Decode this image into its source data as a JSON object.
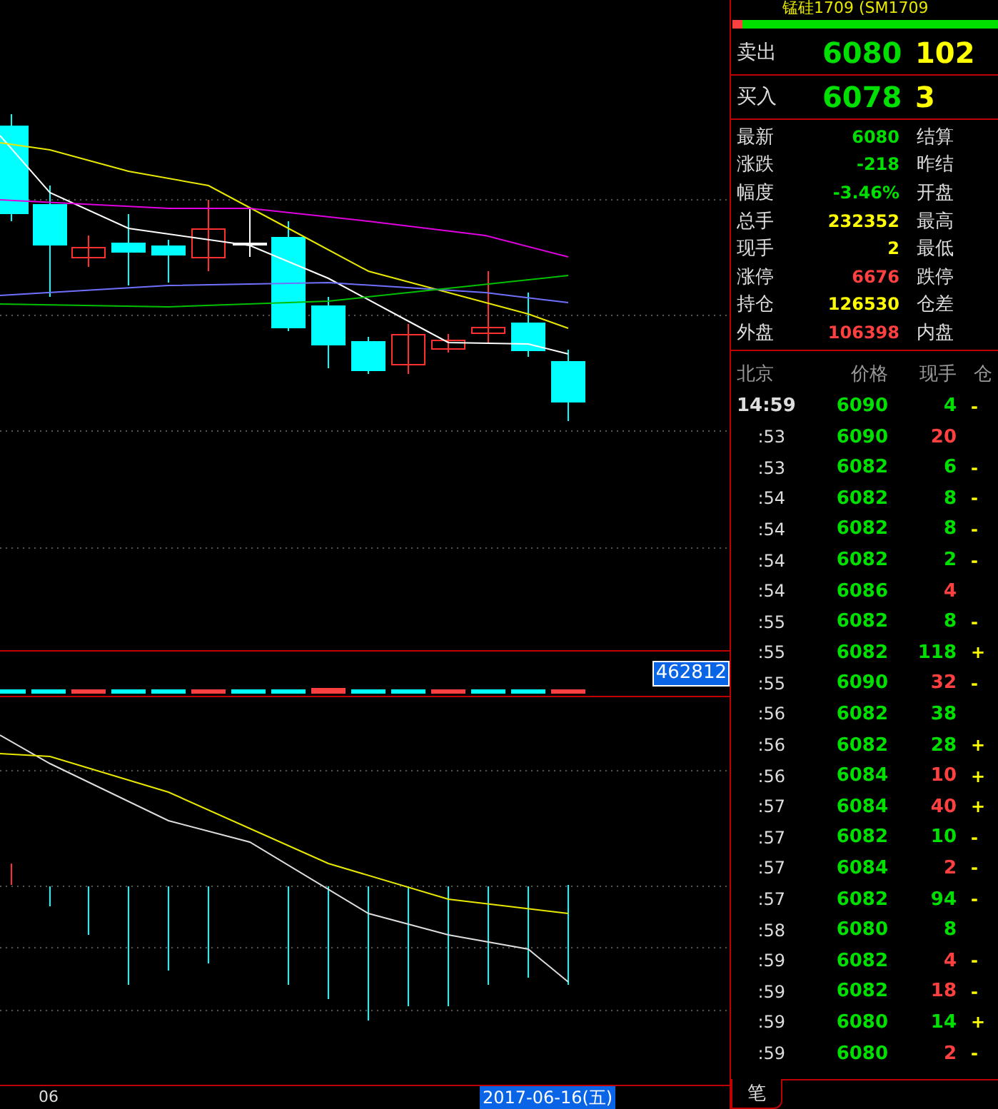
{
  "title": "锰硅1709 (SM1709",
  "ratio_bar": {
    "level": 0.04
  },
  "quotes": [
    {
      "label": "卖出",
      "price": "6080",
      "volume": "102"
    },
    {
      "label": "买入",
      "price": "6078",
      "volume": "3"
    }
  ],
  "stats": [
    {
      "label": "最新",
      "value": "6080",
      "color": "#00e000",
      "label_2": "结算"
    },
    {
      "label": "涨跌",
      "value": "-218",
      "color": "#00e000",
      "label_2": "昨结"
    },
    {
      "label": "幅度",
      "value": "-3.46%",
      "color": "#00e000",
      "label_2": "开盘"
    },
    {
      "label": "总手",
      "value": "232352",
      "color": "#ffff00",
      "label_2": "最高"
    },
    {
      "label": "现手",
      "value": "2",
      "color": "#ffff00",
      "label_2": "最低"
    },
    {
      "label": "涨停",
      "value": "6676",
      "color": "#ff4040",
      "label_2": "跌停"
    },
    {
      "label": "持仓",
      "value": "126530",
      "color": "#ffff00",
      "label_2": "仓差"
    },
    {
      "label": "外盘",
      "value": "106398",
      "color": "#ff4040",
      "label_2": "内盘"
    }
  ],
  "ticks": {
    "columns": [
      "北京",
      "价格",
      "现手",
      "仓"
    ],
    "rows": [
      {
        "time": "14:59",
        "price": "6090",
        "volume": "4",
        "color": "#00e000",
        "column_4": "-"
      },
      {
        "time": ":53",
        "price": "6090",
        "volume": "20",
        "color": "#ff4040",
        "column_4": ""
      },
      {
        "time": ":53",
        "price": "6082",
        "volume": "6",
        "color": "#00e000",
        "column_4": "-"
      },
      {
        "time": ":54",
        "price": "6082",
        "volume": "8",
        "color": "#00e000",
        "column_4": "-"
      },
      {
        "time": ":54",
        "price": "6082",
        "volume": "8",
        "color": "#00e000",
        "column_4": "-"
      },
      {
        "time": ":54",
        "price": "6082",
        "volume": "2",
        "color": "#00e000",
        "column_4": "-"
      },
      {
        "time": ":54",
        "price": "6086",
        "volume": "4",
        "color": "#ff4040",
        "column_4": ""
      },
      {
        "time": ":55",
        "price": "6082",
        "volume": "8",
        "color": "#00e000",
        "column_4": "-"
      },
      {
        "time": ":55",
        "price": "6082",
        "volume": "118",
        "color": "#00e000",
        "column_4": "+"
      },
      {
        "time": ":55",
        "price": "6090",
        "volume": "32",
        "color": "#ff4040",
        "column_4": "-"
      },
      {
        "time": ":56",
        "price": "6082",
        "volume": "38",
        "color": "#00e000",
        "column_4": ""
      },
      {
        "time": ":56",
        "price": "6082",
        "volume": "28",
        "color": "#00e000",
        "column_4": "+"
      },
      {
        "time": ":56",
        "price": "6084",
        "volume": "10",
        "color": "#ff4040",
        "column_4": "+"
      },
      {
        "time": ":57",
        "price": "6084",
        "volume": "40",
        "color": "#ff4040",
        "column_4": "+"
      },
      {
        "time": ":57",
        "price": "6082",
        "volume": "10",
        "color": "#00e000",
        "column_4": "-"
      },
      {
        "time": ":57",
        "price": "6084",
        "volume": "2",
        "color": "#ff4040",
        "column_4": "-"
      },
      {
        "time": ":57",
        "price": "6082",
        "volume": "94",
        "color": "#00e000",
        "column_4": "-"
      },
      {
        "time": ":58",
        "price": "6080",
        "volume": "8",
        "color": "#00e000",
        "column_4": ""
      },
      {
        "time": ":59",
        "price": "6082",
        "volume": "4",
        "color": "#ff4040",
        "column_4": "-"
      },
      {
        "time": ":59",
        "price": "6082",
        "volume": "18",
        "color": "#ff4040",
        "column_4": "-"
      },
      {
        "time": ":59",
        "price": "6080",
        "volume": "14",
        "color": "#00e000",
        "column_4": "+"
      },
      {
        "time": ":59",
        "price": "6080",
        "volume": "2",
        "color": "#ff4040",
        "column_4": "-"
      }
    ]
  },
  "tabs": [
    {
      "label": "笔",
      "selected": true
    }
  ],
  "chart": {
    "volume_label": "462812",
    "x_label": "06",
    "date_label": "2017-06-16(五)"
  }
}
